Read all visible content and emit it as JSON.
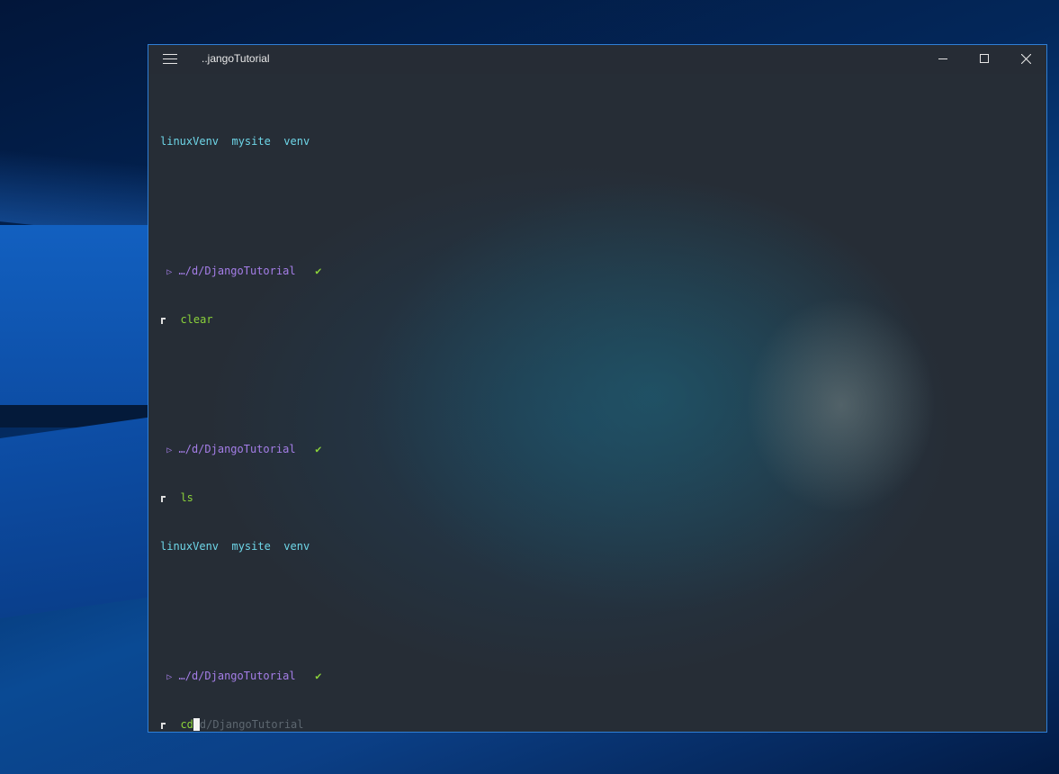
{
  "window": {
    "title": "..jangoTutorial"
  },
  "icons": {
    "menu": "hamburger-menu-icon",
    "minimize": "minimize-icon",
    "maximize": "maximize-icon",
    "close": "close-icon",
    "folder": "folder-icon",
    "check": "check-icon",
    "prompt": "prompt-corner-icon"
  },
  "colors": {
    "directory": "#6ed6e8",
    "path": "#a57ee8",
    "command": "#8bd23a",
    "suggestion": "#5d6770",
    "window_border": "#2f7fd6"
  },
  "terminal": {
    "ls_output_1": [
      "linuxVenv",
      "mysite",
      "venv"
    ],
    "prompt_1": {
      "folder_glyph": "▷",
      "path": "…/d/DjangoTutorial",
      "status": "✔"
    },
    "command_1": "clear",
    "prompt_2": {
      "folder_glyph": "▷",
      "path": "…/d/DjangoTutorial",
      "status": "✔"
    },
    "command_2": "ls",
    "ls_output_2": [
      "linuxVenv",
      "mysite",
      "venv"
    ],
    "prompt_3": {
      "folder_glyph": "▷",
      "path": "…/d/DjangoTutorial",
      "status": "✔"
    },
    "current_input": "cd",
    "autosuggestion": "d/DjangoTutorial"
  }
}
